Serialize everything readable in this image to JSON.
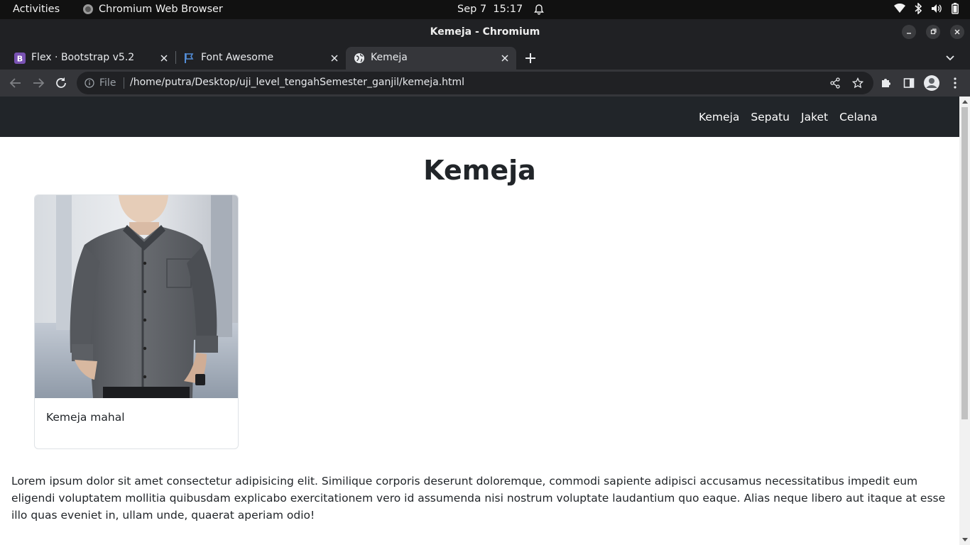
{
  "system_bar": {
    "activities": "Activities",
    "app_name": "Chromium Web Browser",
    "date": "Sep 7",
    "time": "15:17",
    "tray_icons": [
      "wifi-icon",
      "bluetooth-icon",
      "volume-icon",
      "battery-icon"
    ]
  },
  "window": {
    "title": "Kemeja - Chromium"
  },
  "tabs": [
    {
      "label": "Flex · Bootstrap v5.2",
      "icon": "bootstrap-icon",
      "active": false
    },
    {
      "label": "Font Awesome",
      "icon": "flag-icon",
      "active": false
    },
    {
      "label": "Kemeja",
      "icon": "globe-icon",
      "active": true
    }
  ],
  "toolbar": {
    "security_label": "File",
    "url": "/home/putra/Desktop/uji_level_tengahSemester_ganjil/kemeja.html"
  },
  "page": {
    "navbar": {
      "links": [
        "Kemeja",
        "Sepatu",
        "Jaket",
        "Celana"
      ]
    },
    "heading": "Kemeja",
    "card": {
      "caption": "Kemeja mahal"
    },
    "paragraph": "Lorem ipsum dolor sit amet consectetur adipisicing elit. Similique corporis deserunt doloremque, commodi sapiente adipisci accusamus necessitatibus impedit eum eligendi voluptatem mollitia quibusdam explicabo exercitationem vero id assumenda nisi nostrum voluptate laudantium quo eaque. Alias neque libero aut itaque at esse illo quas eveniet in, ullam unde, quaerat aperiam odio!"
  },
  "colors": {
    "navbar_bg": "#212529",
    "browser_frame": "#202124",
    "toolbar_bg": "#35363a",
    "bootstrap_purple": "#7952b3",
    "font_awesome_blue": "#538dd7"
  }
}
